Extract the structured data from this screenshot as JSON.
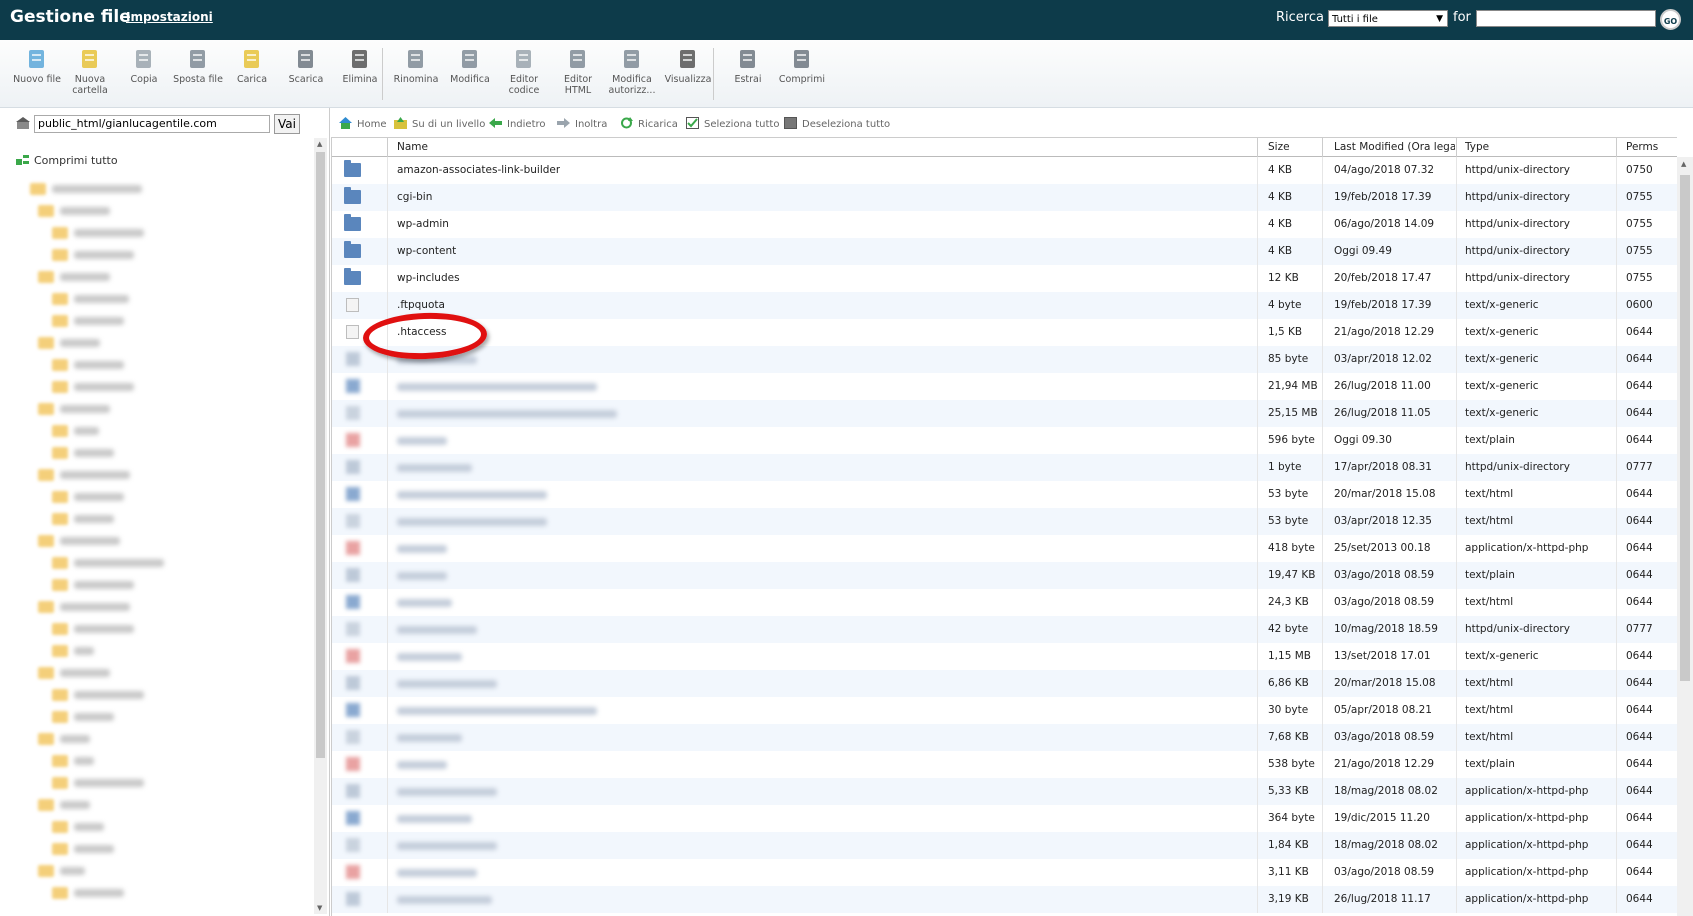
{
  "header": {
    "app_title": "Gestione file",
    "settings_link": "Impostazioni",
    "search_label": "Ricerca",
    "search_scope": "Tutti i file",
    "for_label": "for",
    "search_value": "",
    "go_label": "GO"
  },
  "toolbar": {
    "items": [
      {
        "label": "Nuovo file",
        "icon": "new-file-icon"
      },
      {
        "label": "Nuova cartella",
        "icon": "new-folder-icon"
      },
      {
        "label": "Copia",
        "icon": "copy-icon"
      },
      {
        "label": "Sposta file",
        "icon": "move-file-icon"
      },
      {
        "label": "Carica",
        "icon": "upload-icon"
      },
      {
        "label": "Scarica",
        "icon": "download-icon"
      },
      {
        "label": "Elimina",
        "icon": "delete-icon"
      },
      {
        "label": "Rinomina",
        "icon": "rename-icon"
      },
      {
        "label": "Modifica",
        "icon": "edit-icon"
      },
      {
        "label": "Editor codice",
        "icon": "code-editor-icon"
      },
      {
        "label": "Editor HTML",
        "icon": "html-editor-icon"
      },
      {
        "label": "Modifica autorizz...",
        "icon": "permissions-icon"
      },
      {
        "label": "Visualizza",
        "icon": "view-icon"
      },
      {
        "label": "Estrai",
        "icon": "extract-icon"
      },
      {
        "label": "Comprimi",
        "icon": "compress-icon"
      }
    ]
  },
  "left": {
    "path_value": "public_html/gianlucagentile.com",
    "go_button": "Vai",
    "collapse_all": "Comprimi tutto"
  },
  "nav": {
    "home": "Home",
    "up": "Su di un livello",
    "back": "Indietro",
    "forward": "Inoltra",
    "reload": "Ricarica",
    "select_all": "Seleziona tutto",
    "deselect_all": "Deseleziona tutto"
  },
  "table": {
    "columns": [
      "Name",
      "Size",
      "Last Modified (Ora legale",
      "Type",
      "Perms"
    ],
    "rows": [
      {
        "icon": "folder",
        "name": "amazon-associates-link-builder",
        "size": "4 KB",
        "modified": "04/ago/2018 07.32",
        "type": "httpd/unix-directory",
        "perms": "0750"
      },
      {
        "icon": "folder",
        "name": "cgi-bin",
        "size": "4 KB",
        "modified": "19/feb/2018 17.39",
        "type": "httpd/unix-directory",
        "perms": "0755"
      },
      {
        "icon": "folder",
        "name": "wp-admin",
        "size": "4 KB",
        "modified": "06/ago/2018 14.09",
        "type": "httpd/unix-directory",
        "perms": "0755"
      },
      {
        "icon": "folder",
        "name": "wp-content",
        "size": "4 KB",
        "modified": "Oggi 09.49",
        "type": "httpd/unix-directory",
        "perms": "0755"
      },
      {
        "icon": "folder",
        "name": "wp-includes",
        "size": "12 KB",
        "modified": "20/feb/2018 17.47",
        "type": "httpd/unix-directory",
        "perms": "0755"
      },
      {
        "icon": "file",
        "name": ".ftpquota",
        "size": "4 byte",
        "modified": "19/feb/2018 17.39",
        "type": "text/x-generic",
        "perms": "0600"
      },
      {
        "icon": "file",
        "name": ".htaccess",
        "size": "1,5 KB",
        "modified": "21/ago/2018 12.29",
        "type": "text/x-generic",
        "perms": "0644"
      },
      {
        "icon": "blur",
        "name": "",
        "size": "85 byte",
        "modified": "03/apr/2018 12.02",
        "type": "text/x-generic",
        "perms": "0644"
      },
      {
        "icon": "blur",
        "name": "",
        "size": "21,94 MB",
        "modified": "26/lug/2018 11.00",
        "type": "text/x-generic",
        "perms": "0644"
      },
      {
        "icon": "blur",
        "name": "",
        "size": "25,15 MB",
        "modified": "26/lug/2018 11.05",
        "type": "text/x-generic",
        "perms": "0644"
      },
      {
        "icon": "blur",
        "name": "",
        "size": "596 byte",
        "modified": "Oggi 09.30",
        "type": "text/plain",
        "perms": "0644"
      },
      {
        "icon": "blur",
        "name": "",
        "size": "1 byte",
        "modified": "17/apr/2018 08.31",
        "type": "httpd/unix-directory",
        "perms": "0777"
      },
      {
        "icon": "blur",
        "name": "",
        "size": "53 byte",
        "modified": "20/mar/2018 15.08",
        "type": "text/html",
        "perms": "0644"
      },
      {
        "icon": "blur",
        "name": "",
        "size": "53 byte",
        "modified": "03/apr/2018 12.35",
        "type": "text/html",
        "perms": "0644"
      },
      {
        "icon": "blur",
        "name": "",
        "size": "418 byte",
        "modified": "25/set/2013 00.18",
        "type": "application/x-httpd-php",
        "perms": "0644"
      },
      {
        "icon": "blur",
        "name": "",
        "size": "19,47 KB",
        "modified": "03/ago/2018 08.59",
        "type": "text/plain",
        "perms": "0644"
      },
      {
        "icon": "blur",
        "name": "",
        "size": "24,3 KB",
        "modified": "03/ago/2018 08.59",
        "type": "text/html",
        "perms": "0644"
      },
      {
        "icon": "blur",
        "name": "",
        "size": "42 byte",
        "modified": "10/mag/2018 18.59",
        "type": "httpd/unix-directory",
        "perms": "0777"
      },
      {
        "icon": "blur",
        "name": "",
        "size": "1,15 MB",
        "modified": "13/set/2018 17.01",
        "type": "text/x-generic",
        "perms": "0644"
      },
      {
        "icon": "blur",
        "name": "",
        "size": "6,86 KB",
        "modified": "20/mar/2018 15.08",
        "type": "text/html",
        "perms": "0644"
      },
      {
        "icon": "blur",
        "name": "",
        "size": "30 byte",
        "modified": "05/apr/2018 08.21",
        "type": "text/html",
        "perms": "0644"
      },
      {
        "icon": "blur",
        "name": "",
        "size": "7,68 KB",
        "modified": "03/ago/2018 08.59",
        "type": "text/html",
        "perms": "0644"
      },
      {
        "icon": "blur",
        "name": "",
        "size": "538 byte",
        "modified": "21/ago/2018 12.29",
        "type": "text/plain",
        "perms": "0644"
      },
      {
        "icon": "blur",
        "name": "",
        "size": "5,33 KB",
        "modified": "18/mag/2018 08.02",
        "type": "application/x-httpd-php",
        "perms": "0644"
      },
      {
        "icon": "blur",
        "name": "",
        "size": "364 byte",
        "modified": "19/dic/2015 11.20",
        "type": "application/x-httpd-php",
        "perms": "0644"
      },
      {
        "icon": "blur",
        "name": "",
        "size": "1,84 KB",
        "modified": "18/mag/2018 08.02",
        "type": "application/x-httpd-php",
        "perms": "0644"
      },
      {
        "icon": "blur",
        "name": "",
        "size": "3,11 KB",
        "modified": "03/ago/2018 08.59",
        "type": "application/x-httpd-php",
        "perms": "0644"
      },
      {
        "icon": "blur",
        "name": "",
        "size": "3,19 KB",
        "modified": "26/lug/2018 11.17",
        "type": "application/x-httpd-php",
        "perms": "0644"
      }
    ]
  },
  "colors": {
    "header_bg": "#0d3b4a",
    "row_alt": "#f2f7fd",
    "annotation": "#e01010",
    "folder": "#5a86bd"
  }
}
